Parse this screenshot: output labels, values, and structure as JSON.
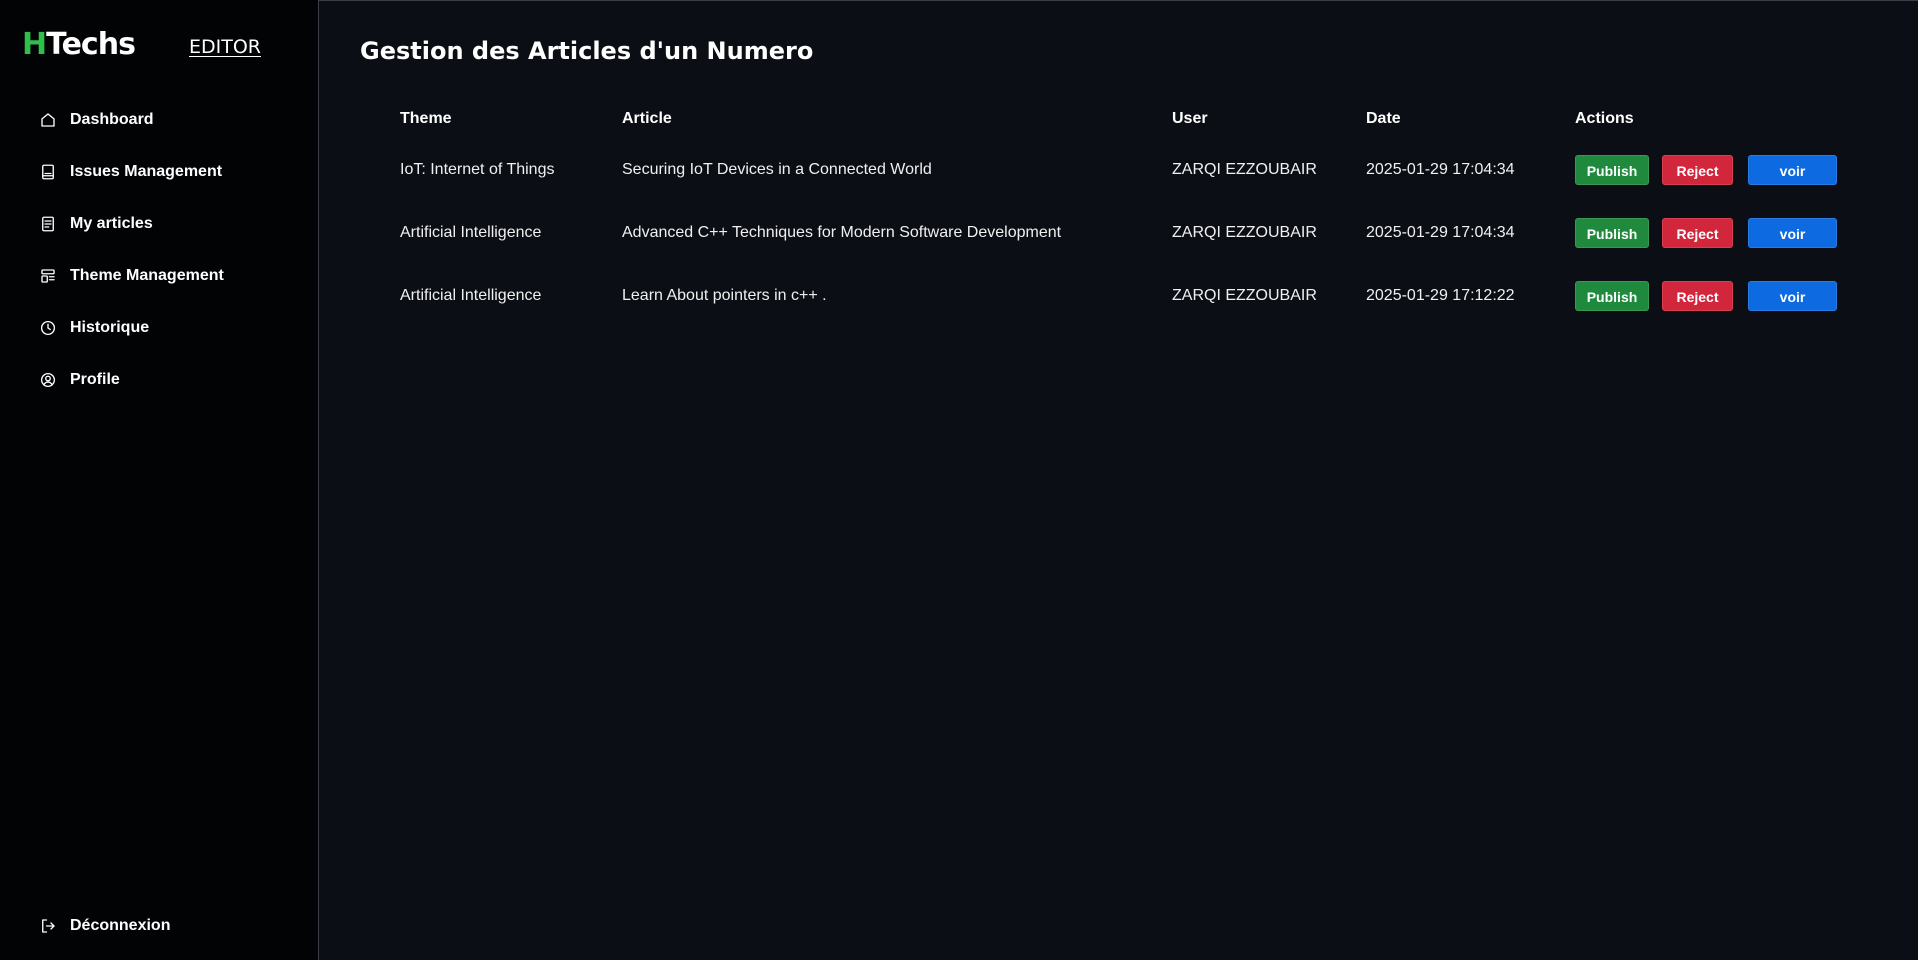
{
  "brand": {
    "logo_mark": "H",
    "logo_rest": "Techs",
    "role_link": "EDITOR"
  },
  "colors": {
    "background": "#0b0e14",
    "sidebar": "#020305",
    "brand_green": "#2fbf4a",
    "publish": "#1f8a3d",
    "reject": "#d1263b",
    "voir": "#0d6ae0"
  },
  "sidebar": {
    "items": [
      {
        "label": "Dashboard",
        "icon": "home-icon"
      },
      {
        "label": "Issues Management",
        "icon": "book-icon"
      },
      {
        "label": "My articles",
        "icon": "document-icon"
      },
      {
        "label": "Theme Management",
        "icon": "layout-icon"
      },
      {
        "label": "Historique",
        "icon": "clock-icon"
      },
      {
        "label": "Profile",
        "icon": "user-circle-icon"
      }
    ],
    "logout": {
      "label": "Déconnexion",
      "icon": "logout-icon"
    }
  },
  "main": {
    "title": "Gestion des Articles d'un Numero",
    "table": {
      "headers": [
        "Theme",
        "Article",
        "User",
        "Date",
        "Actions"
      ],
      "rows": [
        {
          "theme": "IoT: Internet of Things",
          "article": "Securing IoT Devices in a Connected World",
          "user": "ZARQI EZZOUBAIR",
          "date": "2025-01-29 17:04:34"
        },
        {
          "theme": "Artificial Intelligence",
          "article": "Advanced C++ Techniques for Modern Software Development",
          "user": "ZARQI EZZOUBAIR",
          "date": "2025-01-29 17:04:34"
        },
        {
          "theme": "Artificial Intelligence",
          "article": "Learn About pointers in c++ .",
          "user": "ZARQI EZZOUBAIR",
          "date": "2025-01-29 17:12:22"
        }
      ],
      "actions": {
        "publish": "Publish",
        "reject": "Reject",
        "view": "voir"
      }
    }
  }
}
